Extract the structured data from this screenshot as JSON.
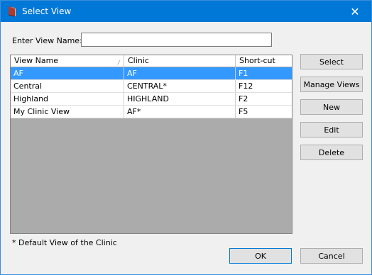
{
  "window": {
    "title": "Select View"
  },
  "form": {
    "view_name_label": "Enter View Name:",
    "view_name_value": "",
    "view_name_placeholder": ""
  },
  "table": {
    "columns": [
      "View Name",
      "Clinic",
      "Short-cut"
    ],
    "rows": [
      {
        "view": "AF",
        "clinic": "AF",
        "shortcut": "F1",
        "selected": true
      },
      {
        "view": "Central",
        "clinic": "CENTRAL*",
        "shortcut": "F12",
        "selected": false
      },
      {
        "view": "Highland",
        "clinic": "HIGHLAND",
        "shortcut": "F2",
        "selected": false
      },
      {
        "view": "My Clinic View",
        "clinic": "AF*",
        "shortcut": "F5",
        "selected": false
      }
    ]
  },
  "buttons": {
    "select": "Select",
    "manage_views": "Manage Views",
    "new": "New",
    "edit": "Edit",
    "delete": "Delete",
    "ok": "OK",
    "cancel": "Cancel"
  },
  "footnote": "* Default View of the Clinic",
  "colors": {
    "titlebar": "#0078d7",
    "selection": "#3399ff",
    "grid_background": "#ababab"
  }
}
